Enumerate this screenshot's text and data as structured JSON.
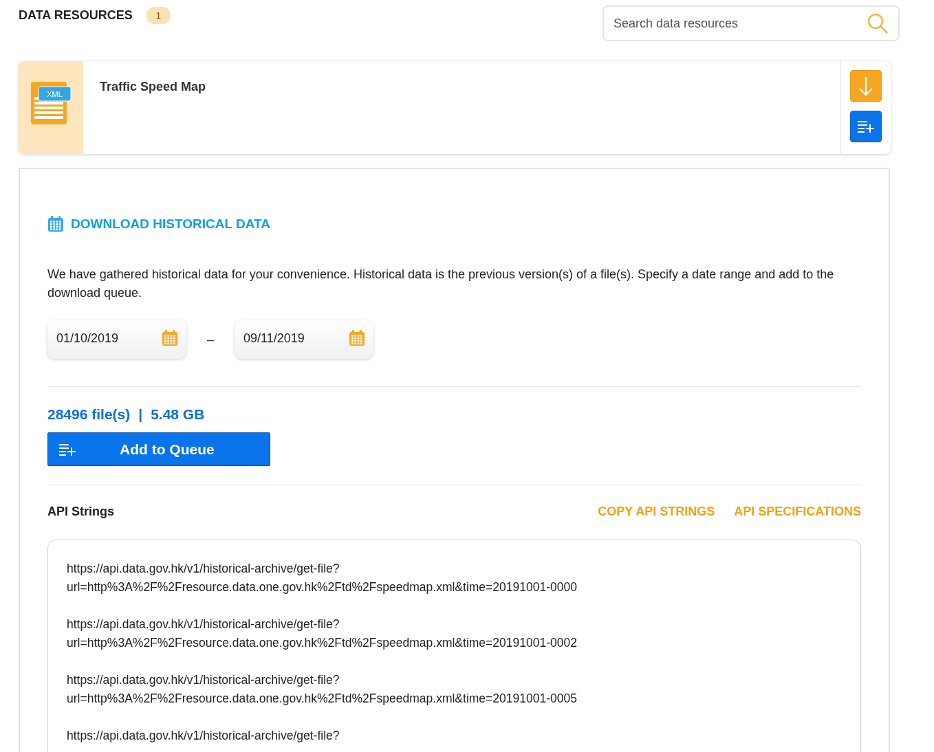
{
  "header": {
    "title": "DATA RESOURCES",
    "count": "1",
    "search": {
      "placeholder": "Search data resources"
    }
  },
  "resource": {
    "format": "XML",
    "name": "Traffic Speed Map"
  },
  "historical": {
    "title": "DOWNLOAD HISTORICAL DATA",
    "description": "We have gathered historical data for your convenience. Historical data is the previous version(s) of a file(s). Specify a date range and add to the download queue.",
    "date_from": "01/10/2019",
    "separator": "–",
    "date_to": "09/11/2019",
    "file_count": "28496 file(s)",
    "divider": "|",
    "size": "5.48 GB",
    "add_button": "Add to Queue"
  },
  "api": {
    "title": "API Strings",
    "links": [
      "COPY API STRINGS",
      "API SPECIFICATIONS"
    ],
    "entries": [
      {
        "lines": [
          "https://api.data.gov.hk/v1/historical-archive/get-file?",
          "url=http%3A%2F%2Fresource.data.one.gov.hk%2Ftd%2Fspeedmap.xml&time=20191001-0000"
        ]
      },
      {
        "lines": [
          "https://api.data.gov.hk/v1/historical-archive/get-file?",
          "url=http%3A%2F%2Fresource.data.one.gov.hk%2Ftd%2Fspeedmap.xml&time=20191001-0002"
        ]
      },
      {
        "lines": [
          "https://api.data.gov.hk/v1/historical-archive/get-file?",
          "url=http%3A%2F%2Fresource.data.one.gov.hk%2Ftd%2Fspeedmap.xml&time=20191001-0005"
        ]
      },
      {
        "lines": [
          "https://api.data.gov.hk/v1/historical-archive/get-file?"
        ]
      }
    ]
  }
}
